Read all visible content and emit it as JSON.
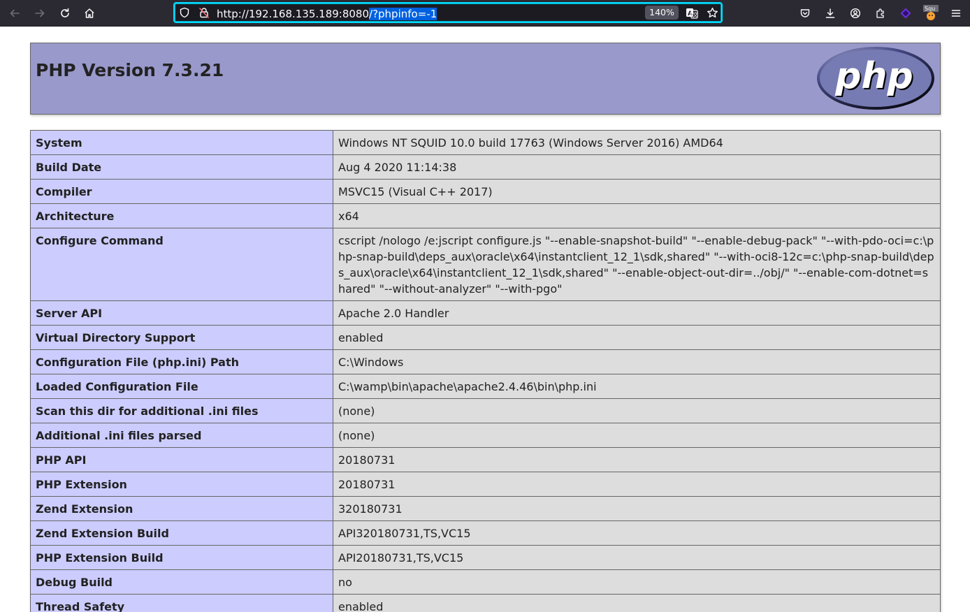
{
  "browser": {
    "url_base": "http://192.168.135.189:8080",
    "url_selected": "/?phpinfo=-1",
    "zoom": "140%",
    "extension_badge": "Squ"
  },
  "page": {
    "title": "PHP Version 7.3.21",
    "logo_text": "php",
    "rows": [
      {
        "key": "System",
        "value": "Windows NT SQUID 10.0 build 17763 (Windows Server 2016) AMD64"
      },
      {
        "key": "Build Date",
        "value": "Aug 4 2020 11:14:38"
      },
      {
        "key": "Compiler",
        "value": "MSVC15 (Visual C++ 2017)"
      },
      {
        "key": "Architecture",
        "value": "x64"
      },
      {
        "key": "Configure Command",
        "value": "cscript /nologo /e:jscript configure.js \"--enable-snapshot-build\" \"--enable-debug-pack\" \"--with-pdo-oci=c:\\php-snap-build\\deps_aux\\oracle\\x64\\instantclient_12_1\\sdk,shared\" \"--with-oci8-12c=c:\\php-snap-build\\deps_aux\\oracle\\x64\\instantclient_12_1\\sdk,shared\" \"--enable-object-out-dir=../obj/\" \"--enable-com-dotnet=shared\" \"--without-analyzer\" \"--with-pgo\""
      },
      {
        "key": "Server API",
        "value": "Apache 2.0 Handler"
      },
      {
        "key": "Virtual Directory Support",
        "value": "enabled"
      },
      {
        "key": "Configuration File (php.ini) Path",
        "value": "C:\\Windows"
      },
      {
        "key": "Loaded Configuration File",
        "value": "C:\\wamp\\bin\\apache\\apache2.4.46\\bin\\php.ini"
      },
      {
        "key": "Scan this dir for additional .ini files",
        "value": "(none)"
      },
      {
        "key": "Additional .ini files parsed",
        "value": "(none)"
      },
      {
        "key": "PHP API",
        "value": "20180731"
      },
      {
        "key": "PHP Extension",
        "value": "20180731"
      },
      {
        "key": "Zend Extension",
        "value": "320180731"
      },
      {
        "key": "Zend Extension Build",
        "value": "API320180731,TS,VC15"
      },
      {
        "key": "PHP Extension Build",
        "value": "API20180731,TS,VC15"
      },
      {
        "key": "Debug Build",
        "value": "no"
      },
      {
        "key": "Thread Safety",
        "value": "enabled"
      }
    ]
  },
  "colors": {
    "header_bg": "#9999cc",
    "key_bg": "#ccccff",
    "value_bg": "#dddddd",
    "toolbar_bg": "#2b2a33",
    "url_focus": "#00ddff"
  }
}
